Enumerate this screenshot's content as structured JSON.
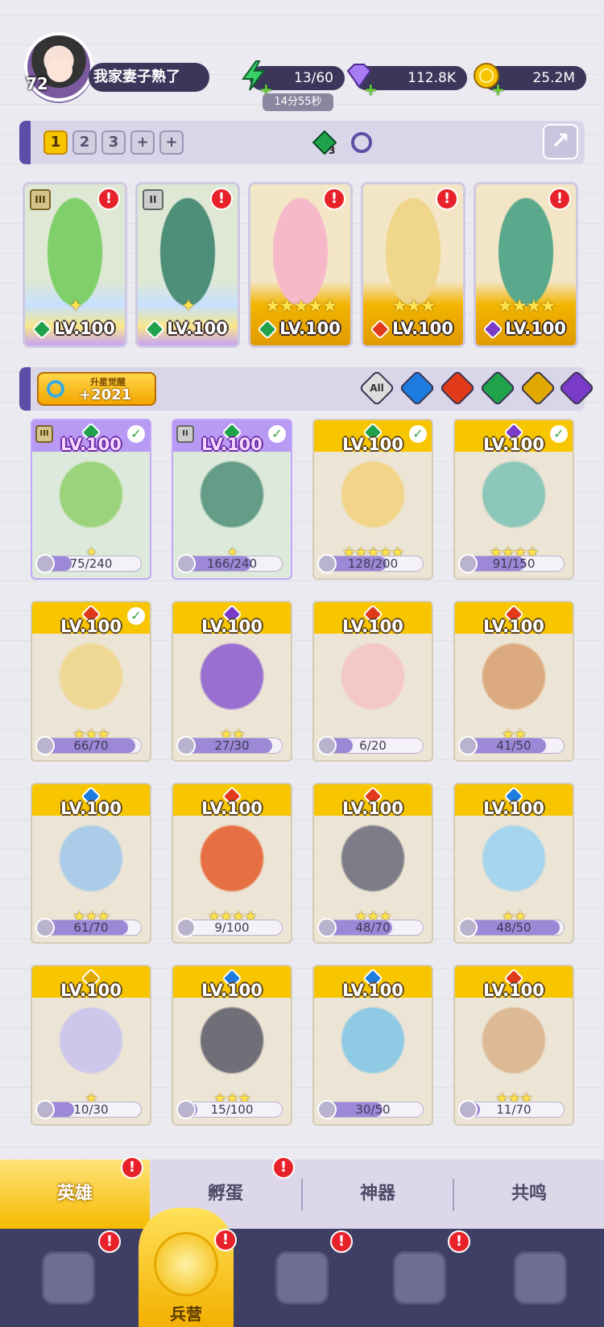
{
  "player": {
    "level": "72",
    "name": "我家妻子熟了"
  },
  "resources": {
    "energy": "13/60",
    "energy_timer": "14分55秒",
    "gems": "112.8K",
    "gold": "25.2M"
  },
  "team_tabs": [
    "1",
    "2",
    "3",
    "+",
    "+"
  ],
  "team_gem_count": "3",
  "team_heroes": [
    {
      "level": "LV.100",
      "element": "wind",
      "rank": "III",
      "rank_style": "gold",
      "stars": "✦",
      "bg": "rainbow",
      "color": "#7fcf6a"
    },
    {
      "level": "LV.100",
      "element": "wind",
      "rank": "II",
      "rank_style": "silver",
      "stars": "✦",
      "bg": "rainbow",
      "color": "#4e8f7a"
    },
    {
      "level": "LV.100",
      "element": "wind",
      "rank": "",
      "rank_style": "",
      "stars": "★★★★★",
      "bg": "gold",
      "color": "#f6b9c9"
    },
    {
      "level": "LV.100",
      "element": "fire",
      "rank": "",
      "rank_style": "",
      "stars": "★★★",
      "bg": "gold",
      "color": "#f0d68a"
    },
    {
      "level": "LV.100",
      "element": "dark",
      "rank": "",
      "rank_style": "",
      "stars": "★★★★",
      "bg": "gold",
      "color": "#5aa98c"
    }
  ],
  "awaken": {
    "title": "升星觉醒",
    "value": "+2021"
  },
  "filters": [
    {
      "name": "filter-all",
      "label": "All"
    },
    {
      "name": "filter-water",
      "label": ""
    },
    {
      "name": "filter-fire",
      "label": ""
    },
    {
      "name": "filter-wind",
      "label": ""
    },
    {
      "name": "filter-light",
      "label": ""
    },
    {
      "name": "filter-dark",
      "label": ""
    }
  ],
  "heroes": [
    {
      "level": "LV.100",
      "element": "wind",
      "progress": "75/240",
      "fraction": 0.31,
      "stars": "✦",
      "checked": true,
      "team": true,
      "rank": "III",
      "rank_style": "gold",
      "color": "#8fcf6a"
    },
    {
      "level": "LV.100",
      "element": "wind",
      "progress": "166/240",
      "fraction": 0.69,
      "stars": "✦",
      "checked": true,
      "team": true,
      "rank": "II",
      "rank_style": "silver",
      "color": "#4e8f7a"
    },
    {
      "level": "LV.100",
      "element": "wind",
      "progress": "128/200",
      "fraction": 0.64,
      "stars": "★★★★★",
      "checked": true,
      "team": false,
      "rank": "",
      "rank_style": "",
      "color": "#f3d27a"
    },
    {
      "level": "LV.100",
      "element": "dark",
      "progress": "91/150",
      "fraction": 0.61,
      "stars": "★★★★",
      "checked": true,
      "team": false,
      "rank": "",
      "rank_style": "",
      "color": "#7cc2b4"
    },
    {
      "level": "LV.100",
      "element": "fire",
      "progress": "66/70",
      "fraction": 0.94,
      "stars": "★★★",
      "checked": true,
      "team": false,
      "rank": "",
      "rank_style": "",
      "color": "#f0d68a"
    },
    {
      "level": "LV.100",
      "element": "dark",
      "progress": "27/30",
      "fraction": 0.9,
      "stars": "★★",
      "checked": false,
      "team": false,
      "rank": "",
      "rank_style": "",
      "color": "#8a5ad0"
    },
    {
      "level": "LV.100",
      "element": "fire",
      "progress": "6/20",
      "fraction": 0.3,
      "stars": "",
      "checked": false,
      "team": false,
      "rank": "",
      "rank_style": "",
      "color": "#f5c3c3"
    },
    {
      "level": "LV.100",
      "element": "fire",
      "progress": "41/50",
      "fraction": 0.82,
      "stars": "★★",
      "checked": false,
      "team": false,
      "rank": "",
      "rank_style": "",
      "color": "#d9a070"
    },
    {
      "level": "LV.100",
      "element": "water",
      "progress": "61/70",
      "fraction": 0.87,
      "stars": "★★★",
      "checked": false,
      "team": false,
      "rank": "",
      "rank_style": "",
      "color": "#9fc8ec"
    },
    {
      "level": "LV.100",
      "element": "fire",
      "progress": "9/100",
      "fraction": 0.09,
      "stars": "★★★★",
      "checked": false,
      "team": false,
      "rank": "",
      "rank_style": "",
      "color": "#e65a2a"
    },
    {
      "level": "LV.100",
      "element": "fire",
      "progress": "48/70",
      "fraction": 0.69,
      "stars": "★★★",
      "checked": false,
      "team": false,
      "rank": "",
      "rank_style": "",
      "color": "#6a6a7a"
    },
    {
      "level": "LV.100",
      "element": "water",
      "progress": "48/50",
      "fraction": 0.96,
      "stars": "★★",
      "checked": false,
      "team": false,
      "rank": "",
      "rank_style": "",
      "color": "#9ad2f2"
    },
    {
      "level": "LV.100",
      "element": "light",
      "progress": "10/30",
      "fraction": 0.33,
      "stars": "★",
      "checked": false,
      "team": false,
      "rank": "",
      "rank_style": "",
      "color": "#c9c2f0"
    },
    {
      "level": "LV.100",
      "element": "water",
      "progress": "15/100",
      "fraction": 0.15,
      "stars": "★★★",
      "checked": false,
      "team": false,
      "rank": "",
      "rank_style": "",
      "color": "#5a5a68"
    },
    {
      "level": "LV.100",
      "element": "water",
      "progress": "30/50",
      "fraction": 0.6,
      "stars": "",
      "checked": false,
      "team": false,
      "rank": "",
      "rank_style": "",
      "color": "#7fc6e8"
    },
    {
      "level": "LV.100",
      "element": "fire",
      "progress": "11/70",
      "fraction": 0.16,
      "stars": "★★★",
      "checked": false,
      "team": false,
      "rank": "",
      "rank_style": "",
      "color": "#d9b38a"
    }
  ],
  "sub_tabs": [
    "英雄",
    "孵蛋",
    "神器",
    "共鸣"
  ],
  "bottom_nav": [
    {
      "name": "nav-cards",
      "label": ""
    },
    {
      "name": "nav-barracks",
      "label": "兵营"
    },
    {
      "name": "nav-map",
      "label": ""
    },
    {
      "name": "nav-shrine",
      "label": ""
    },
    {
      "name": "nav-guild",
      "label": ""
    }
  ],
  "alert_mark": "!"
}
